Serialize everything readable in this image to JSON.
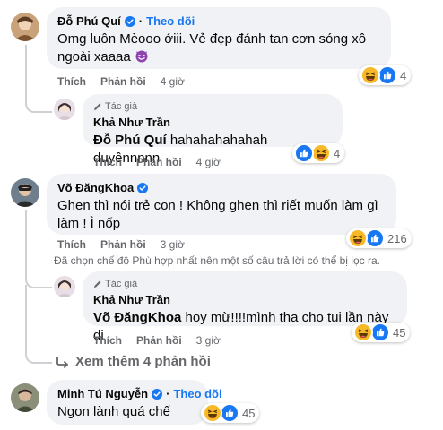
{
  "colors": {
    "accent": "#1877f2",
    "bubble": "#f0f2f5",
    "muted": "#65676b"
  },
  "actions": {
    "like": "Thích",
    "reply": "Phản hồi"
  },
  "comments": [
    {
      "name": "Đỗ Phú Quí",
      "verified": true,
      "follow": "Theo dõi",
      "text_lines": [
        "Omg luôn Mèooo ớiii. Vẻ đẹp đánh tan cơn sóng xô",
        "ngoài xaaaa"
      ],
      "text_emoji": "purple-devil-emoji",
      "time": "4 giờ",
      "reactions": [
        "haha",
        "like"
      ],
      "reaction_count": "4",
      "reply": {
        "author_tag": "Tác giả",
        "name": "Khả Như Trần",
        "mention": "Đỗ Phú Quí",
        "text": "hahahahahahah duyênnnnn",
        "time": "4 giờ",
        "reactions": [
          "like",
          "haha"
        ],
        "reaction_count": "4"
      }
    },
    {
      "name": "Võ ĐăngKhoa",
      "verified": true,
      "text_lines": [
        "Ghen thì nói trẻ con ! Không ghen thì riết muốn làm gì",
        "làm ! Ì nốp"
      ],
      "time": "3 giờ",
      "reactions": [
        "haha",
        "like"
      ],
      "reaction_count": "216",
      "filter_note": "Đã chọn chế độ Phù hợp nhất nên một số câu trả lời có thể bị lọc ra.",
      "reply": {
        "author_tag": "Tác giả",
        "name": "Khả Như Trần",
        "mention": "Võ ĐăngKhoa",
        "text": "hoy mừ!!!!mình tha cho tui lần này đi",
        "time": "3 giờ",
        "reactions": [
          "haha",
          "like"
        ],
        "reaction_count": "45"
      },
      "more_replies": "Xem thêm 4 phản hồi"
    },
    {
      "name": "Minh Tú Nguyễn",
      "verified": true,
      "follow": "Theo dõi",
      "text_lines": [
        "Ngon lành quá chế"
      ],
      "reactions": [
        "haha",
        "like"
      ],
      "reaction_count": "45"
    }
  ]
}
